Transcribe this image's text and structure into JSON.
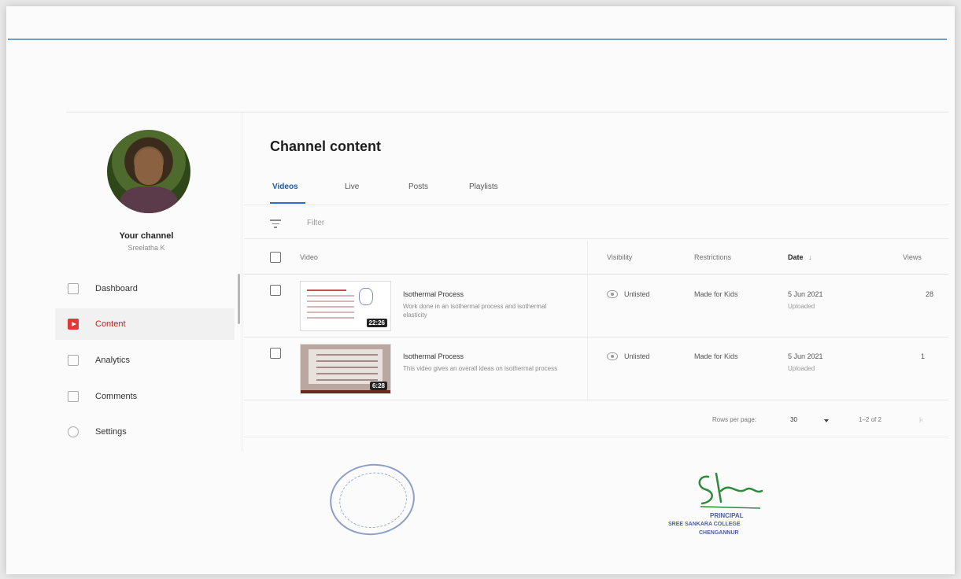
{
  "sidebar": {
    "channel_title": "Your channel",
    "channel_subtitle": "Sreelatha K",
    "items": [
      {
        "label": "Dashboard",
        "icon": "dashboard-icon"
      },
      {
        "label": "Content",
        "icon": "content-play-icon",
        "active": true
      },
      {
        "label": "Analytics",
        "icon": "analytics-icon"
      },
      {
        "label": "Comments",
        "icon": "comments-icon"
      },
      {
        "label": "Settings",
        "icon": "gear-icon"
      }
    ]
  },
  "main": {
    "title": "Channel content",
    "tabs": [
      {
        "label": "Videos",
        "active": true
      },
      {
        "label": "Live"
      },
      {
        "label": "Posts"
      },
      {
        "label": "Playlists"
      }
    ],
    "filter_placeholder": "Filter",
    "columns": {
      "video": "Video",
      "visibility": "Visibility",
      "restrictions": "Restrictions",
      "date": "Date",
      "views": "Views"
    },
    "rows": [
      {
        "title": "Isothermal Process",
        "description": "Work done in an isothermal process and isothermal elasticity",
        "duration": "22:26",
        "visibility": "Unlisted",
        "restrictions": "Made for Kids",
        "date": "5 Jun 2021",
        "date_status": "Uploaded",
        "views": "28"
      },
      {
        "title": "Isothermal Process",
        "description": "This video gives an overall ideas on isothermal process",
        "duration": "6:28",
        "visibility": "Unlisted",
        "restrictions": "Made for Kids",
        "date": "5 Jun 2021",
        "date_status": "Uploaded",
        "views": "1"
      }
    ],
    "pagination": {
      "rows_per_page_label": "Rows per page:",
      "rows_per_page": "30",
      "range": "1–2 of 2"
    }
  },
  "signature_block": {
    "title": "PRINCIPAL",
    "college": "SREE SANKARA COLLEGE",
    "place": "CHENGANNUR"
  },
  "colors": {
    "accent": "#2b6ec2",
    "active_nav": "#e23737",
    "top_rule": "#6f9fc6"
  }
}
